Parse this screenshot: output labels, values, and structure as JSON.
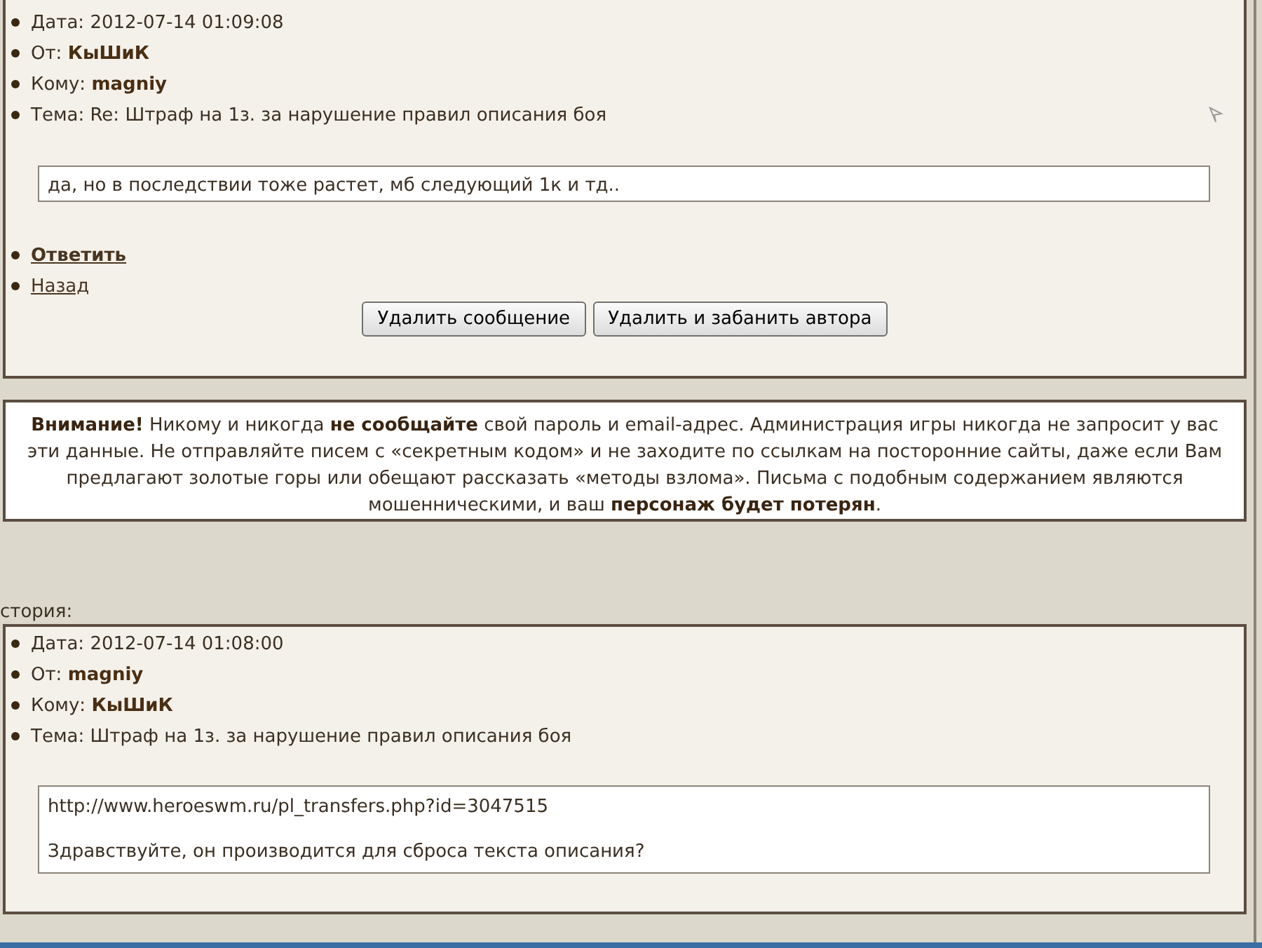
{
  "message": {
    "fields": [
      {
        "label": "Дата:",
        "value": "2012-07-14 01:09:08",
        "kind": "plain"
      },
      {
        "label": "От:",
        "value": "КыШиК",
        "kind": "bold"
      },
      {
        "label": "Кому:",
        "value": "magniy",
        "kind": "bold"
      },
      {
        "label": "Тема:",
        "value": "Re: Штраф на 1з. за нарушение правил описания боя",
        "kind": "plain"
      }
    ],
    "body": [
      "да, но в последствии тоже растет, мб следующий 1к и тд.."
    ],
    "links": [
      {
        "label": "Ответить",
        "kind": "bold"
      },
      {
        "label": "Назад",
        "kind": "plain"
      }
    ],
    "buttons": [
      "Удалить сообщение",
      "Удалить и забанить автора"
    ]
  },
  "notice": "**Внимание!** Никому и никогда **не сообщайте** свой пароль и email-адрес. Администрация игры никогда не запросит у вас эти данные. Не отправляйте писем с «секретным кодом» и не заходите по ссылкам на посторонние сайты, даже если Вам предлагают золотые горы или обещают рассказать «методы взлома». Письма с подобным содержанием являются мошенническими, и ваш **персонаж будет потерян**.",
  "history": {
    "title": "стория:",
    "fields": [
      {
        "label": "Дата:",
        "value": "2012-07-14 01:08:00",
        "kind": "plain"
      },
      {
        "label": "От:",
        "value": "magniy",
        "kind": "bold"
      },
      {
        "label": "Кому:",
        "value": "КыШиК",
        "kind": "bold"
      },
      {
        "label": "Тема:",
        "value": "Штраф на 1з. за нарушение правил описания боя",
        "kind": "plain"
      }
    ],
    "body": [
      "http://www.heroeswm.ru/pl_transfers.php?id=3047515",
      "Здравствуйте, он производится для сброса текста описания?"
    ]
  }
}
